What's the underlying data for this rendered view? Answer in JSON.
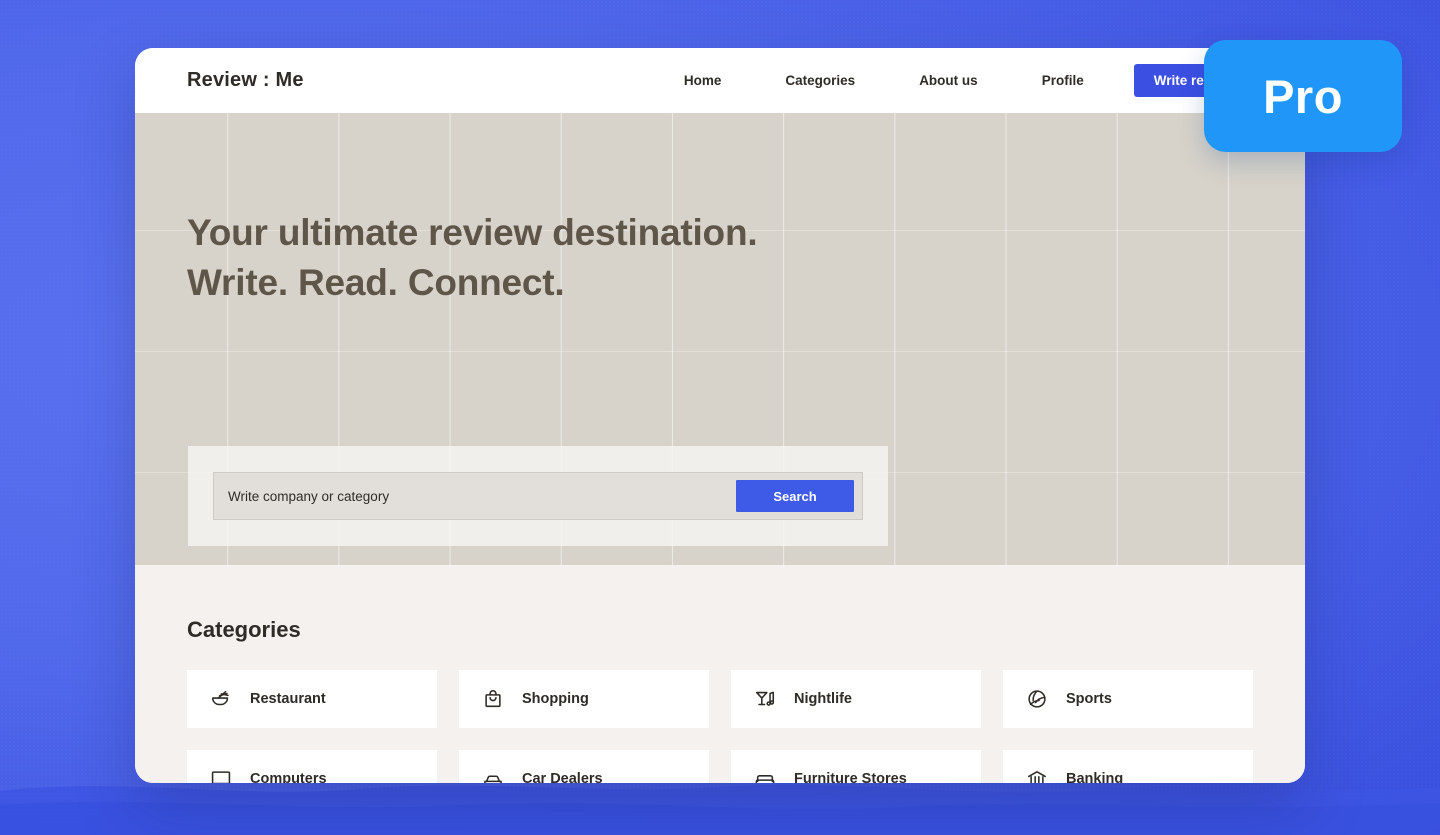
{
  "badge": {
    "label": "Pro"
  },
  "header": {
    "logo": "Review : Me",
    "nav": [
      {
        "label": "Home"
      },
      {
        "label": "Categories"
      },
      {
        "label": "About us"
      },
      {
        "label": "Profile"
      }
    ],
    "cta": {
      "label": "Write review"
    }
  },
  "hero": {
    "heading": "Your ultimate review destination.\nWrite. Read. Connect.",
    "search": {
      "placeholder": "Write company or category",
      "value": "",
      "button_label": "Search"
    }
  },
  "categories": {
    "title": "Categories",
    "items": [
      {
        "label": "Restaurant",
        "icon": "noodle-bowl-icon"
      },
      {
        "label": "Shopping",
        "icon": "shopping-bag-icon"
      },
      {
        "label": "Nightlife",
        "icon": "cocktail-music-icon"
      },
      {
        "label": "Sports",
        "icon": "volleyball-icon"
      },
      {
        "label": "Computers",
        "icon": "monitor-icon"
      },
      {
        "label": "Car Dealers",
        "icon": "car-icon"
      },
      {
        "label": "Furniture Stores",
        "icon": "sofa-icon"
      },
      {
        "label": "Banking",
        "icon": "bank-icon"
      }
    ]
  },
  "colors": {
    "page_background": "#4f66e8",
    "accent_button": "#3b4fe3",
    "search_button": "#3e5be8",
    "badge": "#2196f9",
    "hero_background": "#d7d3ca",
    "hero_heading_text": "#5e5648",
    "categories_background": "#f5f1ee",
    "card_background": "#ffffff",
    "text_dark": "#2f2b27"
  }
}
